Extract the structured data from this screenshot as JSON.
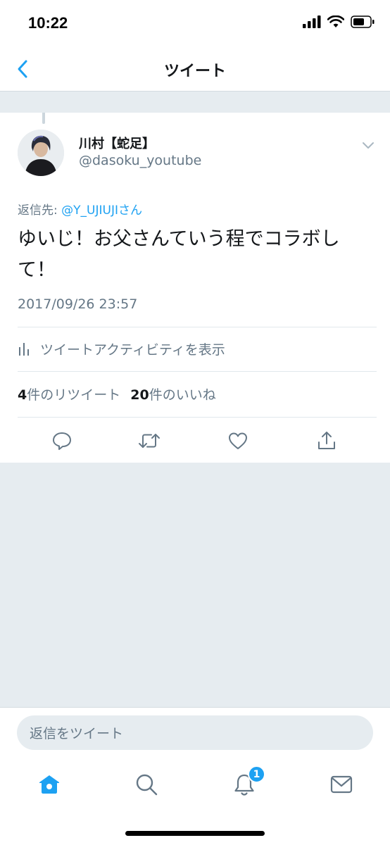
{
  "status": {
    "time": "10:22"
  },
  "nav": {
    "title": "ツイート"
  },
  "tweet": {
    "display_name": "川村【蛇足】",
    "username": "@dasoku_youtube",
    "reply_prefix": "返信先:",
    "reply_mention": "@Y_UJIUJI",
    "reply_suffix": "さん",
    "text": "ゆいじ！お父さんていう程でコラボして！",
    "timestamp": "2017/09/26 23:57",
    "activity_label": "ツイートアクティビティを表示",
    "retweets_count": "4",
    "retweets_label": "件のリツイート",
    "likes_count": "20",
    "likes_label": "件のいいね"
  },
  "reply_bar": {
    "placeholder": "返信をツイート"
  },
  "tabs": {
    "notifications_badge": "1"
  },
  "colors": {
    "accent": "#1da1f2",
    "secondary_text": "#657786",
    "background": "#e6ecf0"
  },
  "icons": [
    "back-chevron-icon",
    "caret-down-icon",
    "activity-chart-icon",
    "reply-icon",
    "retweet-icon",
    "like-icon",
    "share-icon",
    "home-icon",
    "search-icon",
    "notifications-icon",
    "messages-icon"
  ]
}
